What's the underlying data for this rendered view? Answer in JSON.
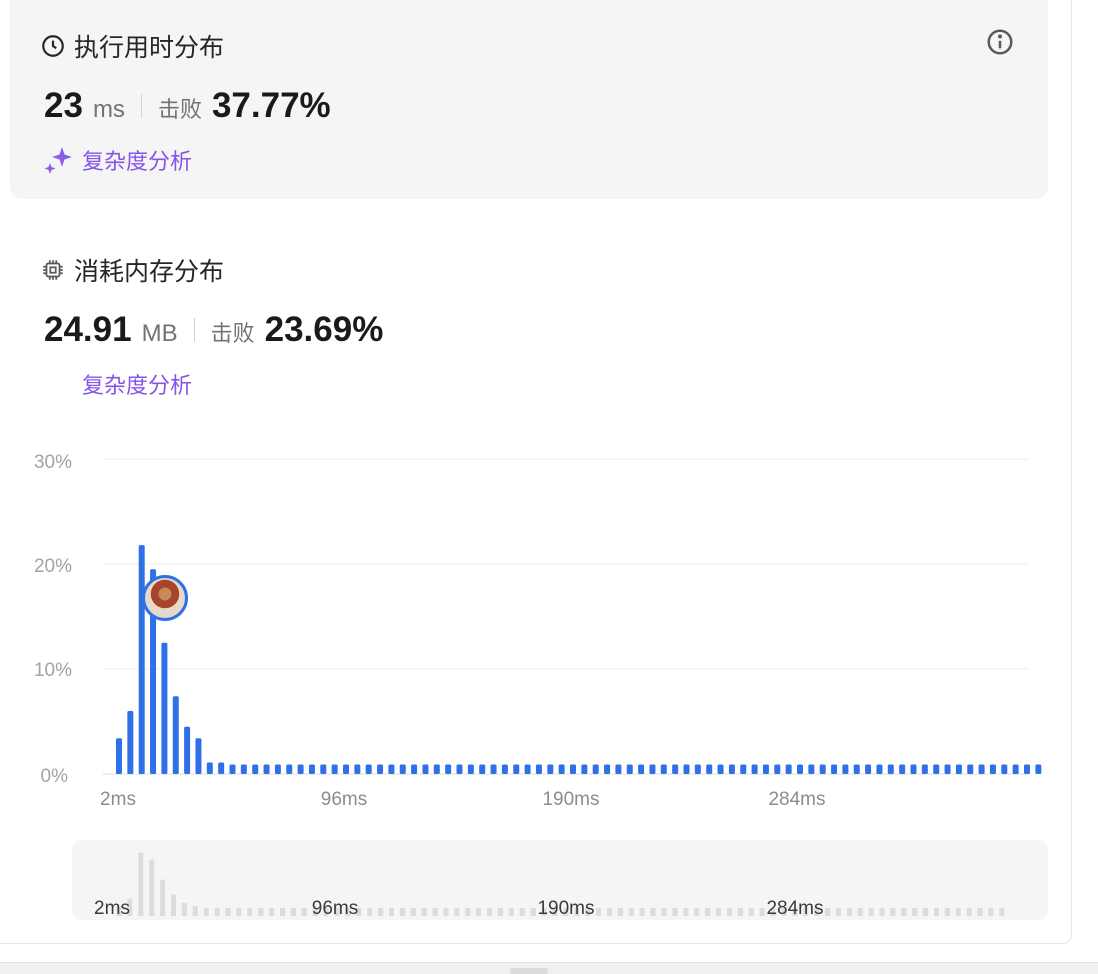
{
  "runtime": {
    "title": "执行用时分布",
    "value": "23",
    "unit": "ms",
    "beat_label": "击败",
    "beat_percent": "37.77%",
    "complexity_label": "复杂度分析"
  },
  "memory": {
    "title": "消耗内存分布",
    "value": "24.91",
    "unit": "MB",
    "beat_label": "击败",
    "beat_percent": "23.69%",
    "complexity_label": "复杂度分析"
  },
  "icons": {
    "runtime": "clock-icon",
    "memory": "chip-icon",
    "info": "info-icon",
    "complexity": "sparkle-icon"
  },
  "colors": {
    "bar": "#2f6fe8",
    "complexity": "#8455e6",
    "mini_bar": "#dcdcdc"
  },
  "chart_data": {
    "type": "bar",
    "y_ticks": [
      "30%",
      "20%",
      "10%",
      "0%"
    ],
    "x_ticks": [
      "2ms",
      "96ms",
      "190ms",
      "284ms"
    ],
    "ylim": [
      0,
      30
    ],
    "grid": true,
    "highlighted_bar_index": 3,
    "values": [
      3.4,
      6.0,
      21.8,
      19.5,
      12.5,
      7.4,
      4.5,
      3.4,
      1.1,
      1.1,
      0.9,
      0.9,
      0.9,
      0.9,
      0.9,
      0.9,
      0.9,
      0.9,
      0.9,
      0.9,
      0.9,
      0.9,
      0.9,
      0.9,
      0.9,
      0.9,
      0.9,
      0.9,
      0.9,
      0.9,
      0.9,
      0.9,
      0.9,
      0.9,
      0.9,
      0.9,
      0.9,
      0.9,
      0.9,
      0.9,
      0.9,
      0.9,
      0.9,
      0.9,
      0.9,
      0.9,
      0.9,
      0.9,
      0.9,
      0.9,
      0.9,
      0.9,
      0.9,
      0.9,
      0.9,
      0.9,
      0.9,
      0.9,
      0.9,
      0.9,
      0.9,
      0.9,
      0.9,
      0.9,
      0.9,
      0.9,
      0.9,
      0.9,
      0.9,
      0.9,
      0.9,
      0.9,
      0.9,
      0.9,
      0.9,
      0.9,
      0.9,
      0.9,
      0.9,
      0.9,
      0.9,
      0.9
    ]
  },
  "mini_chart": {
    "x_ticks": [
      "2ms",
      "96ms",
      "190ms",
      "284ms"
    ]
  }
}
